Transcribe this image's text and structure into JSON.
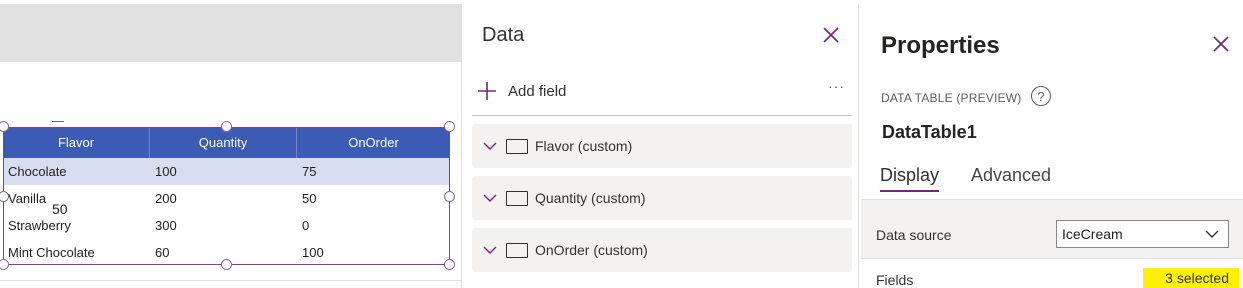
{
  "canvas": {
    "table": {
      "columns": [
        "Flavor",
        "Quantity",
        "OnOrder"
      ],
      "rows": [
        [
          "Chocolate",
          "100",
          "75"
        ],
        [
          "Vanilla",
          "200",
          "50"
        ],
        [
          "Strawberry",
          "300",
          "0"
        ],
        [
          "Mint Chocolate",
          "60",
          "100"
        ]
      ],
      "selected_row": 0
    },
    "overlay_value": "50",
    "accent_color": "#3b5bb5"
  },
  "data_pane": {
    "title": "Data",
    "add_field_label": "Add field",
    "more_label": "···",
    "fields": [
      {
        "label": "Flavor (custom)"
      },
      {
        "label": "Quantity (custom)"
      },
      {
        "label": "OnOrder (custom)"
      }
    ]
  },
  "properties": {
    "title": "Properties",
    "control_type": "DATA TABLE (PREVIEW)",
    "help_icon": "?",
    "control_name": "DataTable1",
    "tabs": [
      {
        "label": "Display",
        "active": true
      },
      {
        "label": "Advanced",
        "active": false
      }
    ],
    "data_source_label": "Data source",
    "data_source_value": "IceCream",
    "fields_label": "Fields",
    "fields_badge": "3 selected",
    "highlight_color": "#fff100",
    "tab_accent_color": "#742774"
  }
}
